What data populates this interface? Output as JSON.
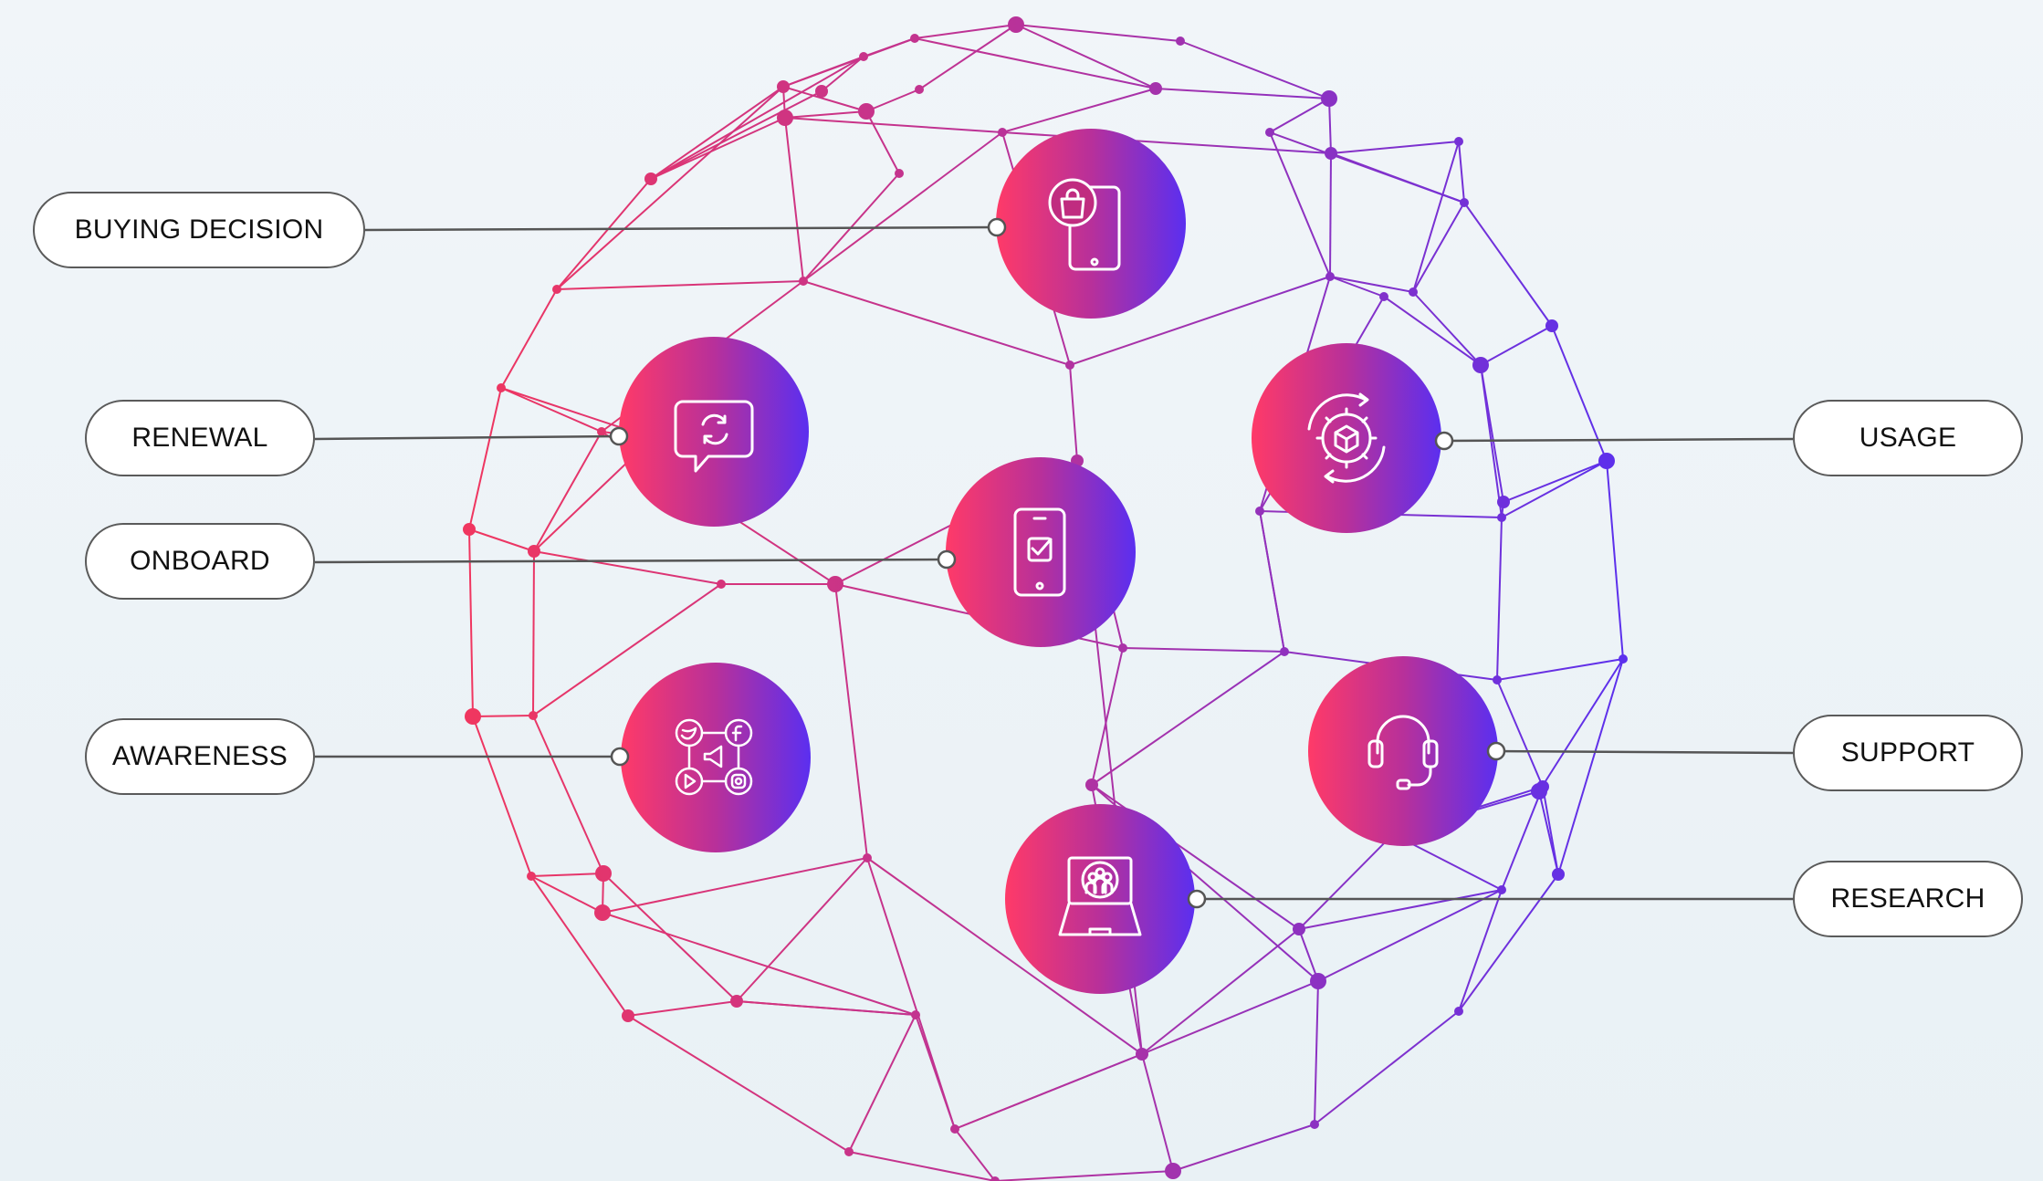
{
  "labels": {
    "buying_decision": "BUYING DECISION",
    "renewal": "RENEWAL",
    "onboard": "ONBOARD",
    "awareness": "AWARENESS",
    "usage": "USAGE",
    "support": "SUPPORT",
    "research": "RESEARCH"
  },
  "colors": {
    "gradient_start": "#ff3a6a",
    "gradient_mid": "#b3309a",
    "gradient_end": "#5a2ef0",
    "mesh_pink": "#e2366e",
    "mesh_purple": "#6a36e8",
    "connector": "#555555"
  },
  "nodes": [
    {
      "id": "buying-decision",
      "icon": "phone-shopping-bag-icon"
    },
    {
      "id": "renewal",
      "icon": "chat-refresh-icon"
    },
    {
      "id": "onboard",
      "icon": "phone-checkmark-icon"
    },
    {
      "id": "awareness",
      "icon": "social-media-icon"
    },
    {
      "id": "usage",
      "icon": "gear-box-cycle-icon"
    },
    {
      "id": "support",
      "icon": "headset-icon"
    },
    {
      "id": "research",
      "icon": "laptop-people-icon"
    }
  ]
}
